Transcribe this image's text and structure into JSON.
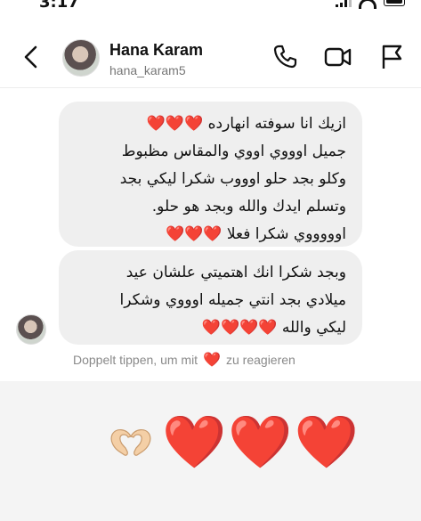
{
  "status_bar": {
    "time": "3:17"
  },
  "header": {
    "name": "Hana Karam",
    "handle": "hana_karam5"
  },
  "messages": [
    {
      "lines": [
        "ازيك انا سوفته انهارده ❤️❤️❤️",
        "جميل اوووي اووي والمقاس مظبوط",
        "وكلو بجد حلو اوووب شكرا ليكي بجد",
        "وتسلم ايدك والله وبجد هو حلو.",
        "اوووووي شكرا فعلا ❤️❤️❤️"
      ]
    },
    {
      "lines": [
        "وبجد شكرا انك اهتميتي علشان عيد",
        "ميلادي بجد انتي جميله اوووي وشكرا",
        "ليكي  والله ❤️❤️❤️❤️"
      ]
    }
  ],
  "hint": {
    "text_before": "Doppelt tippen, um mit",
    "text_after": "zu reagieren",
    "emoji": "❤️"
  },
  "reactions": [
    "🫶",
    "❤️",
    "❤️",
    "❤️"
  ],
  "colors": {
    "heart": "#e8192c",
    "bubble": "#efefef",
    "reaction_bar": "#f4f4f4"
  }
}
